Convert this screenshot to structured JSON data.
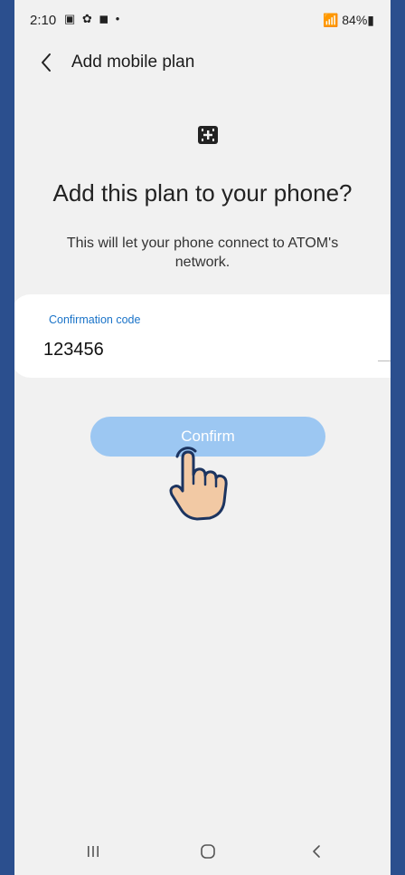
{
  "status_bar": {
    "time": "2:10",
    "left_icons": "▣ ✿ ◼ •",
    "right_icons": "📶 84%▮"
  },
  "app_bar": {
    "title": "Add mobile plan"
  },
  "main": {
    "heading": "Add this plan to your phone?",
    "subtext": "This will let your phone connect to ATOM's network.",
    "field_label": "Confirmation code",
    "field_value": "123456",
    "confirm_label": "Confirm"
  },
  "colors": {
    "accent": "#1a73c8",
    "button_bg": "#9cc7f2",
    "frame": "#2b4f8e"
  },
  "icons": [
    "back-arrow-icon",
    "sim-card-icon",
    "tap-hand-icon",
    "recents-icon",
    "home-icon",
    "nav-back-icon"
  ]
}
